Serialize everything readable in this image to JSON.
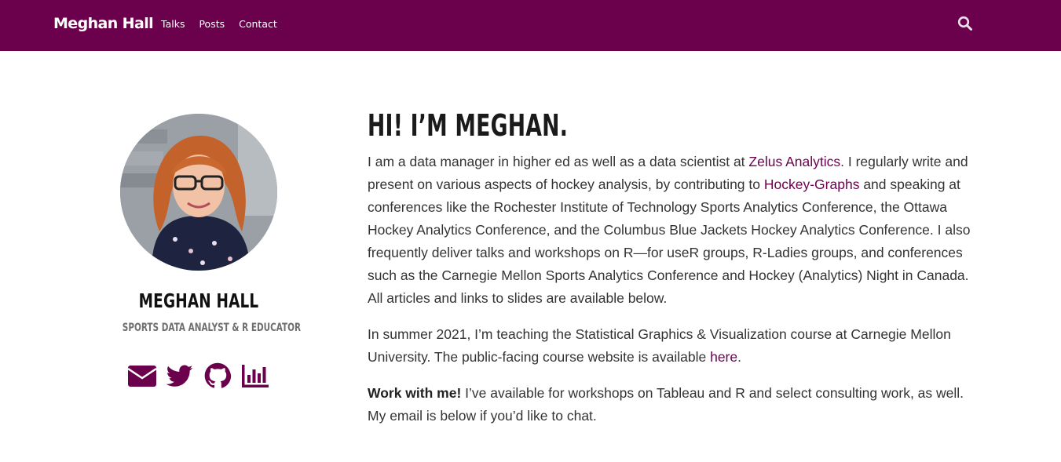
{
  "nav": {
    "brand": "Meghan Hall",
    "links": [
      "Talks",
      "Posts",
      "Contact"
    ],
    "search_icon": "search-icon"
  },
  "sidebar": {
    "name": "MEGHAN HALL",
    "tagline": "SPORTS DATA ANALYST & R EDUCATOR",
    "social_icons": [
      "envelope-icon",
      "twitter-icon",
      "github-icon",
      "bar-chart-icon"
    ]
  },
  "main": {
    "greeting": "HI! I’M MEGHAN.",
    "p1": {
      "t1": "I am a data manager in higher ed as well as a data scientist at ",
      "link1": "Zelus Analytics",
      "t2": ". I regularly write and present on various aspects of hockey analysis, by contributing to ",
      "link2": "Hockey-Graphs",
      "t3": " and speaking at conferences like the Rochester Institute of Technology Sports Analytics Conference, the Ottawa Hockey Analytics Conference, and the Columbus Blue Jackets Hockey Analytics Conference. I also frequently deliver talks and workshops on R—for useR groups, R-Ladies groups, and conferences such as the Carnegie Mellon Sports Analytics Conference and Hockey (Analytics) Night in Canada. All articles and links to slides are available below."
    },
    "p2": {
      "t1": "In summer 2021, I’m teaching the Statistical Graphics & Visualization course at Carnegie Mellon University. The public-facing course website is available ",
      "link": "here",
      "t2": "."
    },
    "p3": {
      "bold": "Work with me!",
      "t1": " I’ve available for workshops on Tableau and R and select consulting work, as well. My email is below if you’d like to chat."
    }
  },
  "colors": {
    "brand": "#6b004d",
    "text": "#333333"
  }
}
